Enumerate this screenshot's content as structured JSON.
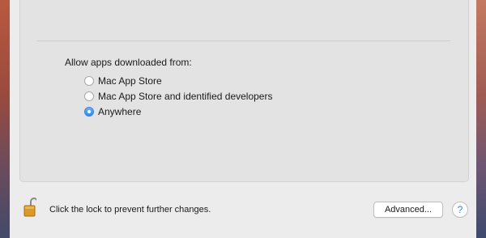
{
  "security": {
    "section_label": "Allow apps downloaded from:",
    "options": [
      {
        "label": "Mac App Store",
        "selected": false
      },
      {
        "label": "Mac App Store and identified developers",
        "selected": false
      },
      {
        "label": "Anywhere",
        "selected": true
      }
    ]
  },
  "footer": {
    "lock_icon": "open-padlock-icon",
    "lock_text": "Click the lock to prevent further changes.",
    "advanced_label": "Advanced...",
    "help_label": "?"
  },
  "colors": {
    "accent": "#2e87f0",
    "lock_gold": "#d89a2a"
  }
}
